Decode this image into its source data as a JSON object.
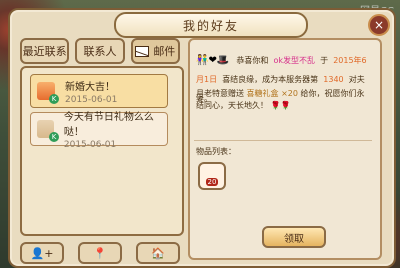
{
  "window": {
    "title": "我的好友",
    "close_glyph": "×"
  },
  "watermark": "网易CC",
  "tabs": [
    {
      "label": "最近联系"
    },
    {
      "label": "联系人"
    },
    {
      "label": "邮件"
    }
  ],
  "mail_list": [
    {
      "title": "新婚大吉！",
      "date": "2015-06-01",
      "badge": "K",
      "icon": "gift-icon"
    },
    {
      "title": "今天有节日礼物么么哒！",
      "date": "2015-06-01",
      "badge": "K",
      "icon": "letter-icon"
    }
  ],
  "bottom_buttons": [
    {
      "glyph": "👤+"
    },
    {
      "glyph": "📍"
    },
    {
      "glyph": "🏠"
    }
  ],
  "detail": {
    "emoji": "👫❤🎩",
    "line1_prefix": "恭喜你和",
    "partner_name": "ok发型不乱",
    "line1_mid": "于",
    "date": "2015年6月1日",
    "line1_suffix": "喜结良缘，成为本服务器第",
    "couple_no": "1340",
    "line1_end": "对夫妻。",
    "line2_prefix": "月老特意赠送",
    "gift_name": "喜糖礼盒",
    "gift_qty": "×20",
    "line2_suffix": "给你，祝愿你们永结同心，天长地久！",
    "line2_emoji": "🌹🌹",
    "items_label": "物品列表：",
    "item_count": "20",
    "claim_label": "领取"
  }
}
